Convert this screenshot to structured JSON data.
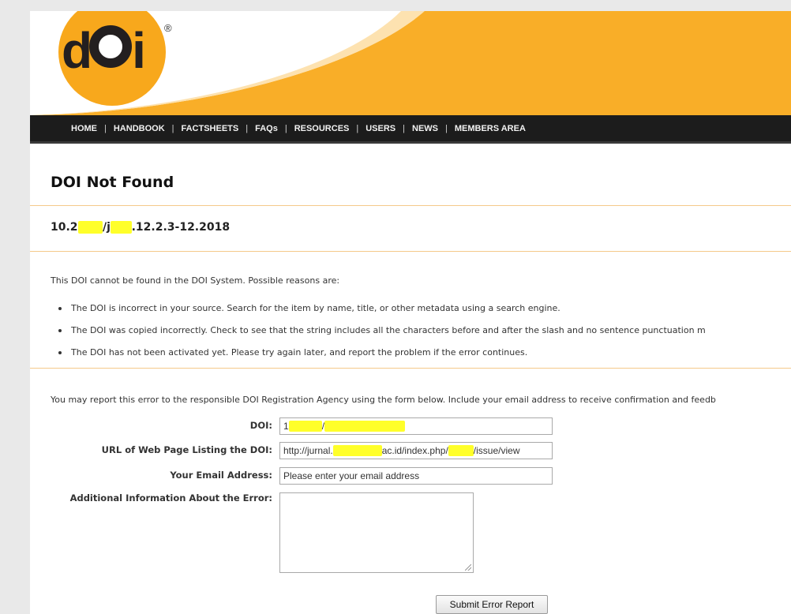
{
  "logo": {
    "text_prefix": "d",
    "text_suffix": "i",
    "registered": "®"
  },
  "nav": {
    "items": [
      "HOME",
      "HANDBOOK",
      "FACTSHEETS",
      "FAQs",
      "RESOURCES",
      "USERS",
      "NEWS",
      "MEMBERS AREA"
    ],
    "separator": "|"
  },
  "page_title": "DOI Not Found",
  "doi_value": {
    "prefix": "10.2",
    "middle": "/j",
    "suffix": ".12.2.3-12.2018"
  },
  "intro": "This DOI cannot be found in the DOI System. Possible reasons are:",
  "reasons": [
    "The DOI is incorrect in your source. Search for the item by name, title, or other metadata using a search engine.",
    "The DOI was copied incorrectly. Check to see that the string includes all the characters before and after the slash and no sentence punctuation m",
    "The DOI has not been activated yet. Please try again later, and report the problem if the error continues."
  ],
  "report_text": "You may report this error to the responsible DOI Registration Agency using the form below. Include your email address to receive confirmation and feedb",
  "form": {
    "doi_label": "DOI:",
    "doi_value_start": "1",
    "doi_value_mid": "/",
    "url_label": "URL of Web Page Listing the DOI:",
    "url_parts": [
      "http://jurnal.",
      "ac.id/index.php/",
      "/issue/view"
    ],
    "email_label": "Your Email Address:",
    "email_placeholder": "Please enter your email address",
    "additional_label": "Additional Information About the Error:",
    "submit_label": "Submit Error Report"
  },
  "colors": {
    "brand_orange": "#f8a81c",
    "nav_background": "#1c1c1c",
    "divider": "#f5c98a",
    "redaction": "#ffff2a"
  }
}
